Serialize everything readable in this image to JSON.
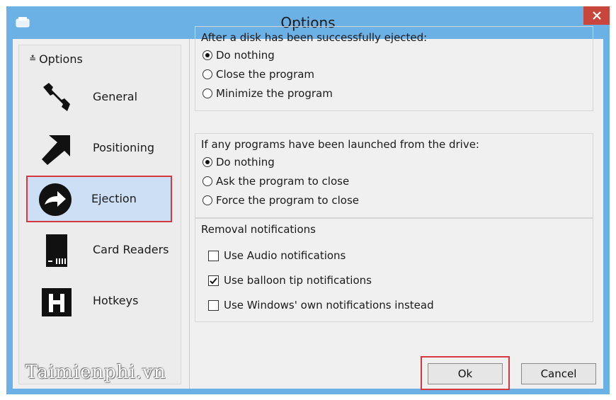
{
  "window": {
    "title": "Options"
  },
  "sidebar": {
    "header": "Options",
    "items": [
      {
        "label": "General",
        "icon": "wrench-icon"
      },
      {
        "label": "Positioning",
        "icon": "arrow-icon"
      },
      {
        "label": "Ejection",
        "icon": "eject-arrow-icon",
        "selected": true
      },
      {
        "label": "Card Readers",
        "icon": "sd-card-icon"
      },
      {
        "label": "Hotkeys",
        "icon": "hotkey-h-icon"
      }
    ]
  },
  "ejected_group": {
    "title": "After a disk has been successfully ejected:",
    "options": [
      "Do nothing",
      "Close the program",
      "Minimize the program"
    ],
    "selected": "Do nothing"
  },
  "programs_group": {
    "title": "If any programs have been launched from the drive:",
    "options": [
      "Do nothing",
      "Ask the program to close",
      "Force the program to close"
    ],
    "selected": "Do nothing"
  },
  "notifications_group": {
    "title": "Removal notifications",
    "options": [
      {
        "label": "Use Audio notifications",
        "checked": false
      },
      {
        "label": "Use balloon tip notifications",
        "checked": true
      },
      {
        "label": "Use Windows' own notifications instead",
        "checked": false
      }
    ]
  },
  "buttons": {
    "ok": "Ok",
    "cancel": "Cancel"
  },
  "watermark": "Taimienphi.vn",
  "colors": {
    "titlebar": "#6cb1e6",
    "close": "#c9463d",
    "highlight": "#d6383f",
    "selected_bg": "#cddff5"
  }
}
